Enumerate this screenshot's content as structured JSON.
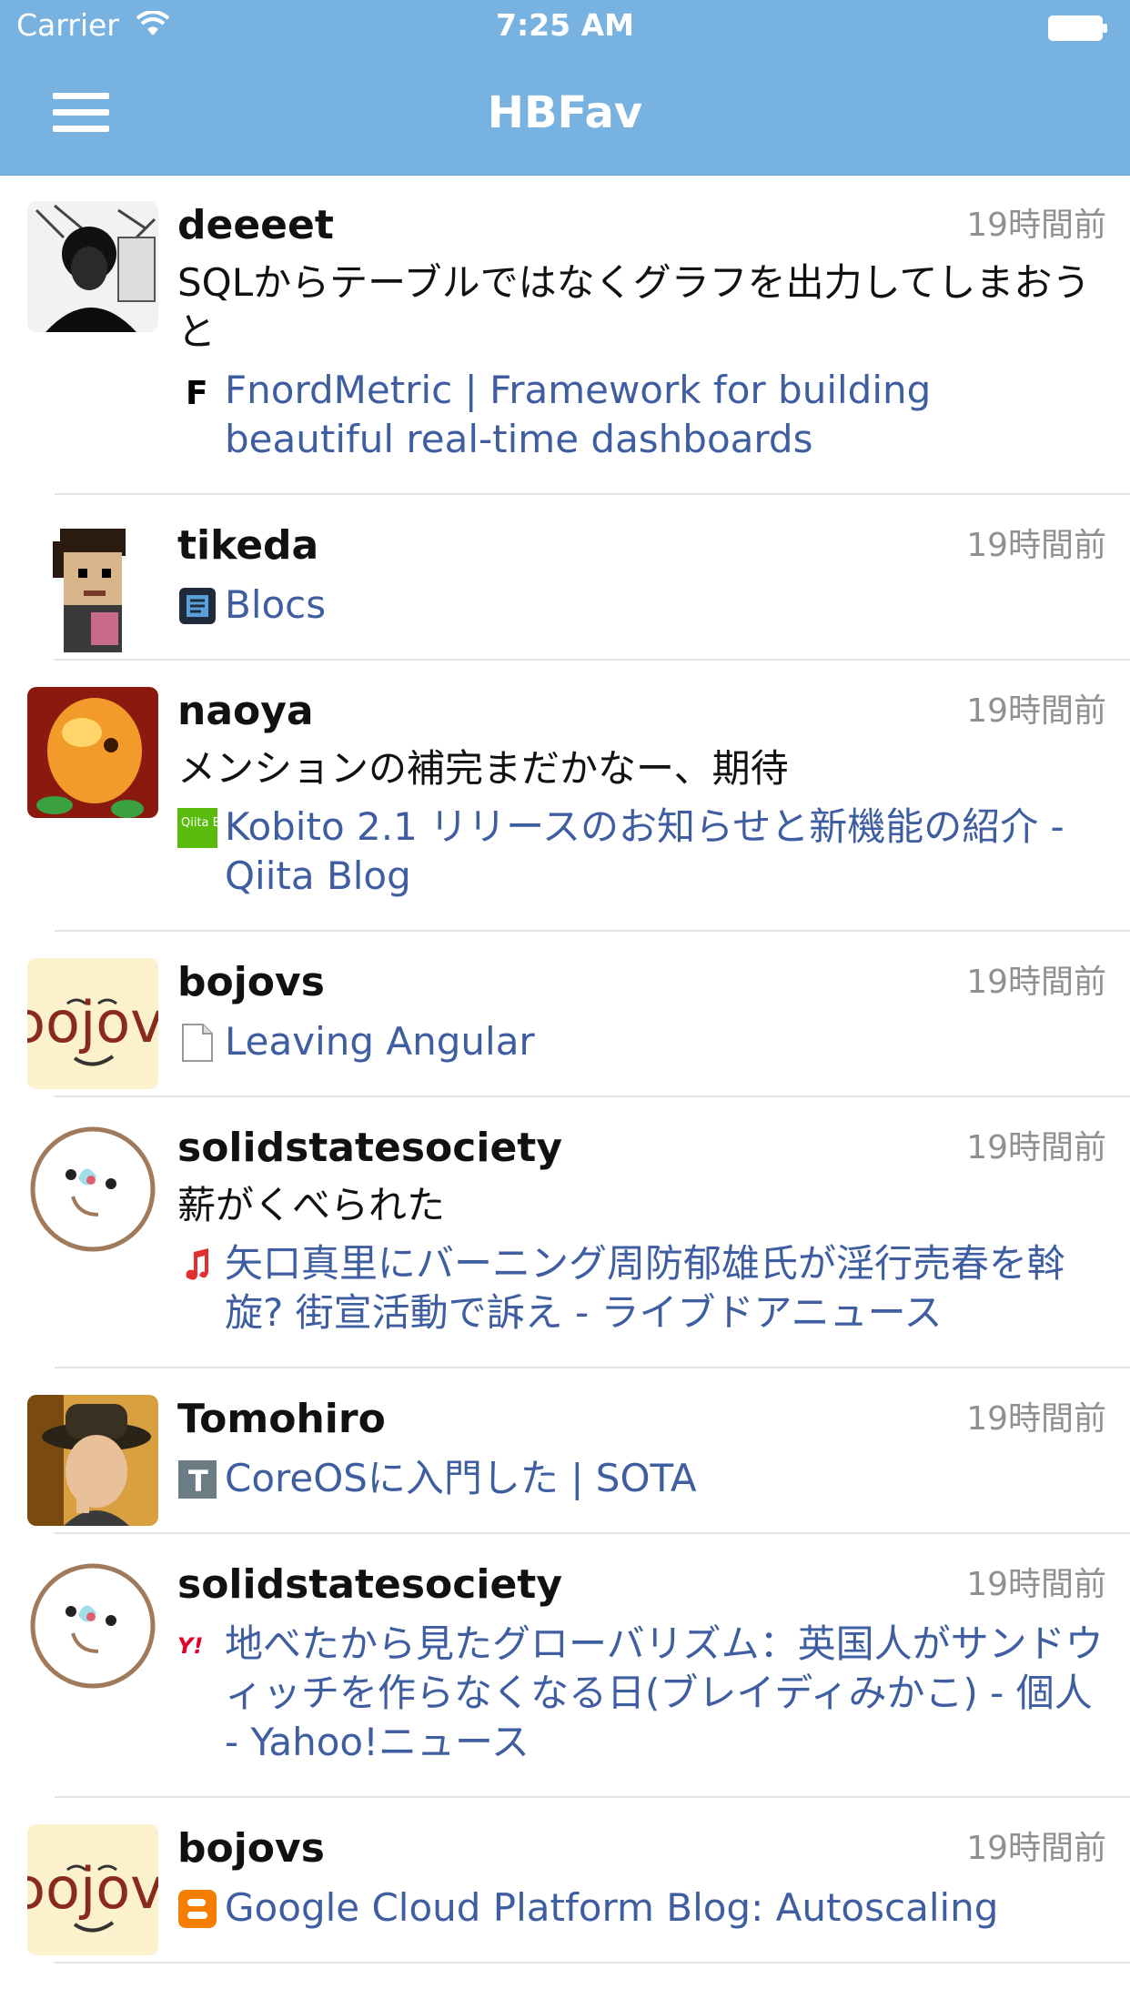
{
  "status_bar": {
    "carrier": "Carrier",
    "time": "7:25 AM"
  },
  "nav": {
    "title": "HBFav"
  },
  "entries": [
    {
      "user": "deeeet",
      "time": "19時間前",
      "comment": "SQLからテーブルではなくグラフを出力してしまおうと",
      "link": "FnordMetric | Framework for building beautiful real-time dashboards",
      "favicon": "letter-f-icon"
    },
    {
      "user": "tikeda",
      "time": "19時間前",
      "comment": "",
      "link": "Blocs",
      "favicon": "document-box-icon"
    },
    {
      "user": "naoya",
      "time": "19時間前",
      "comment": "メンションの補完まだかなー、期待",
      "link": "Kobito 2.1 リリースのお知らせと新機能の紹介 - Qiita Blog",
      "favicon": "qiita-icon"
    },
    {
      "user": "bojovs",
      "time": "19時間前",
      "comment": "",
      "link": "Leaving Angular",
      "favicon": "page-icon"
    },
    {
      "user": "solidstatesociety",
      "time": "19時間前",
      "comment": "薪がくべられた",
      "link": "矢口真里にバーニング周防郁雄氏が淫行売春を斡旋? 街宣活動で訴え - ライブドアニュース",
      "favicon": "livedoor-icon"
    },
    {
      "user": "Tomohiro",
      "time": "19時間前",
      "comment": "",
      "link": "CoreOSに入門した | SOTA",
      "favicon": "letter-t-icon"
    },
    {
      "user": "solidstatesociety",
      "time": "19時間前",
      "comment": "",
      "link": "地べたから見たグローバリズム：英国人がサンドウィッチを作らなくなる日(ブレイディみかこ) - 個人 - Yahoo!ニュース",
      "favicon": "yahoo-icon"
    },
    {
      "user": "bojovs",
      "time": "19時間前",
      "comment": "",
      "link": "Google Cloud Platform Blog: Autoscaling",
      "favicon": "blogger-icon"
    }
  ],
  "avatar_labels": {
    "bojovs": "ɔojov"
  },
  "favicon_labels": {
    "f": "F",
    "qiita": "Qiita Blog",
    "t": "T",
    "yahoo": "Y!"
  },
  "colors": {
    "nav": "#77b2e0",
    "link": "#3f5da1",
    "time": "#8f8f94"
  }
}
